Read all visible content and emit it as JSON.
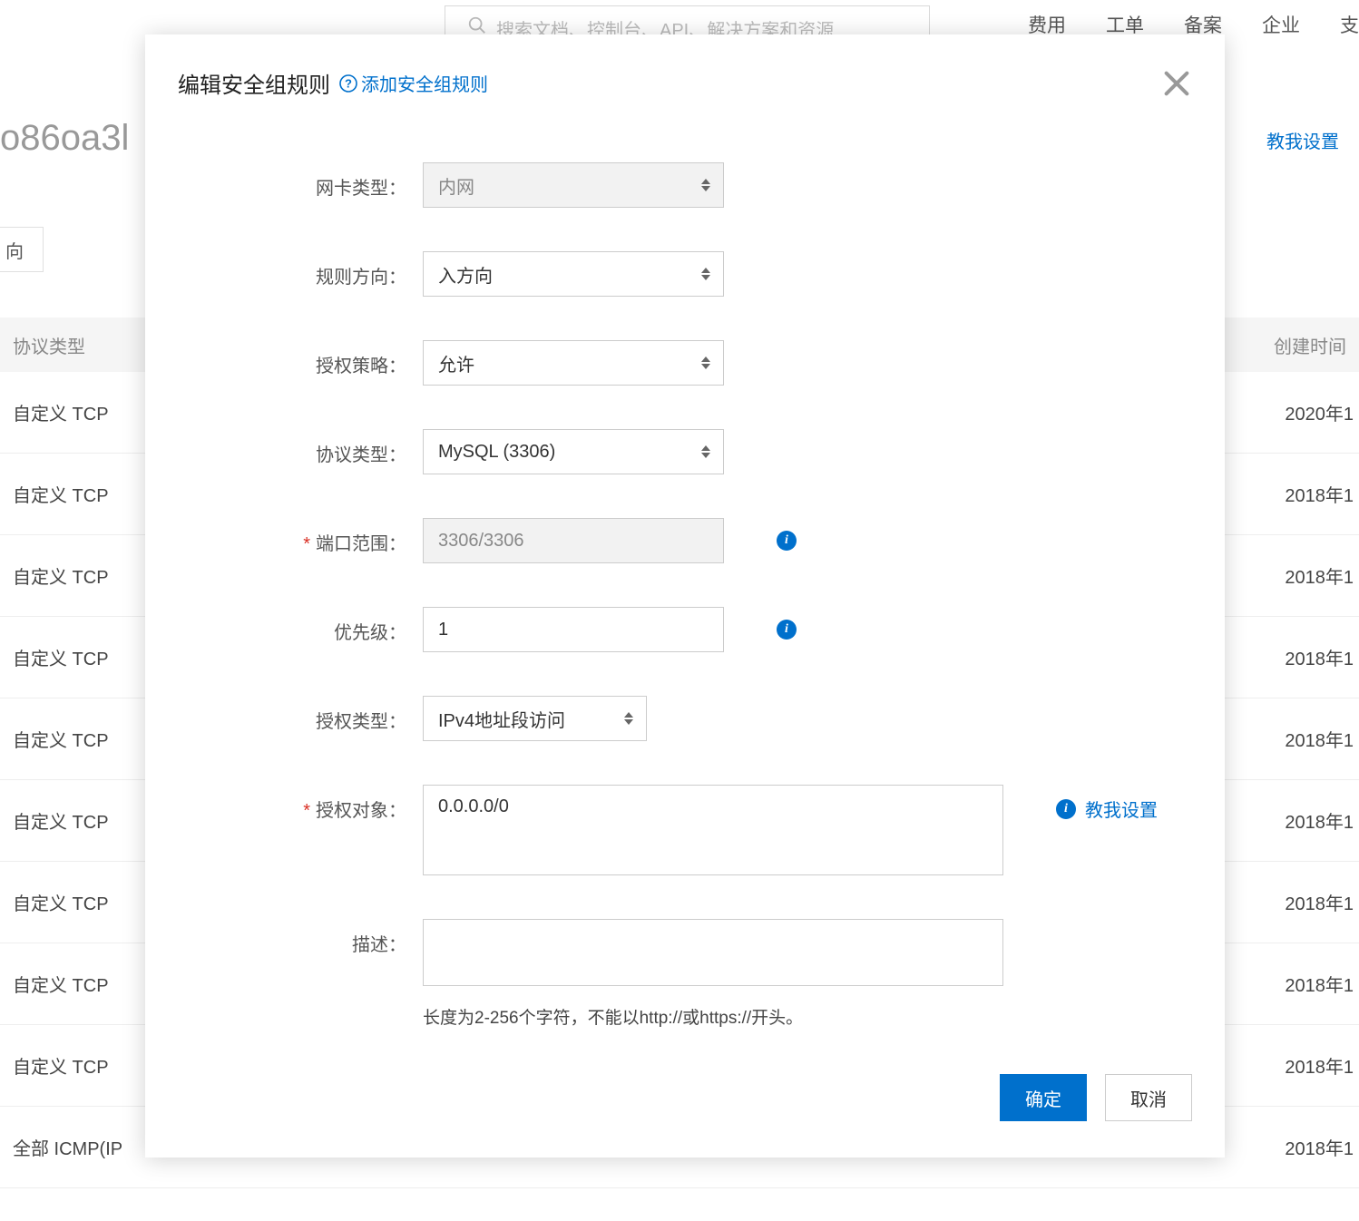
{
  "header": {
    "search_placeholder": "搜索文档、控制台、API、解决方案和资源",
    "nav": [
      "费用",
      "工单",
      "备案",
      "企业",
      "支"
    ]
  },
  "bg": {
    "title_fragment": "o86oa3l",
    "teach_link": "教我设置",
    "tab_label": "向",
    "table": {
      "col_protocol": "协议类型",
      "col_created": "创建时间",
      "rows": [
        {
          "protocol": "自定义 TCP",
          "created": "2020年1"
        },
        {
          "protocol": "自定义 TCP",
          "created": "2018年1"
        },
        {
          "protocol": "自定义 TCP",
          "created": "2018年1"
        },
        {
          "protocol": "自定义 TCP",
          "created": "2018年1"
        },
        {
          "protocol": "自定义 TCP",
          "created": "2018年1"
        },
        {
          "protocol": "自定义 TCP",
          "created": "2018年1"
        },
        {
          "protocol": "自定义 TCP",
          "created": "2018年1"
        },
        {
          "protocol": "自定义 TCP",
          "created": "2018年1"
        },
        {
          "protocol": "自定义 TCP",
          "created": "2018年1"
        },
        {
          "protocol": "全部 ICMP(IP",
          "created": "2018年1"
        }
      ]
    }
  },
  "modal": {
    "title": "编辑安全组规则",
    "add_rule_link": "添加安全组规则",
    "teach_me": "教我设置",
    "labels": {
      "nic_type": "网卡类型：",
      "direction": "规则方向：",
      "policy": "授权策略：",
      "protocol": "协议类型：",
      "port_range": "端口范围：",
      "priority": "优先级：",
      "auth_type": "授权类型：",
      "auth_object": "授权对象：",
      "description": "描述："
    },
    "values": {
      "nic_type": "内网",
      "direction": "入方向",
      "policy": "允许",
      "protocol": "MySQL (3306)",
      "port_range": "3306/3306",
      "priority": "1",
      "auth_type": "IPv4地址段访问",
      "auth_object": "0.0.0.0/0",
      "description": ""
    },
    "hints": {
      "description": "长度为2-256个字符，不能以http://或https://开头。"
    },
    "buttons": {
      "ok": "确定",
      "cancel": "取消"
    }
  }
}
